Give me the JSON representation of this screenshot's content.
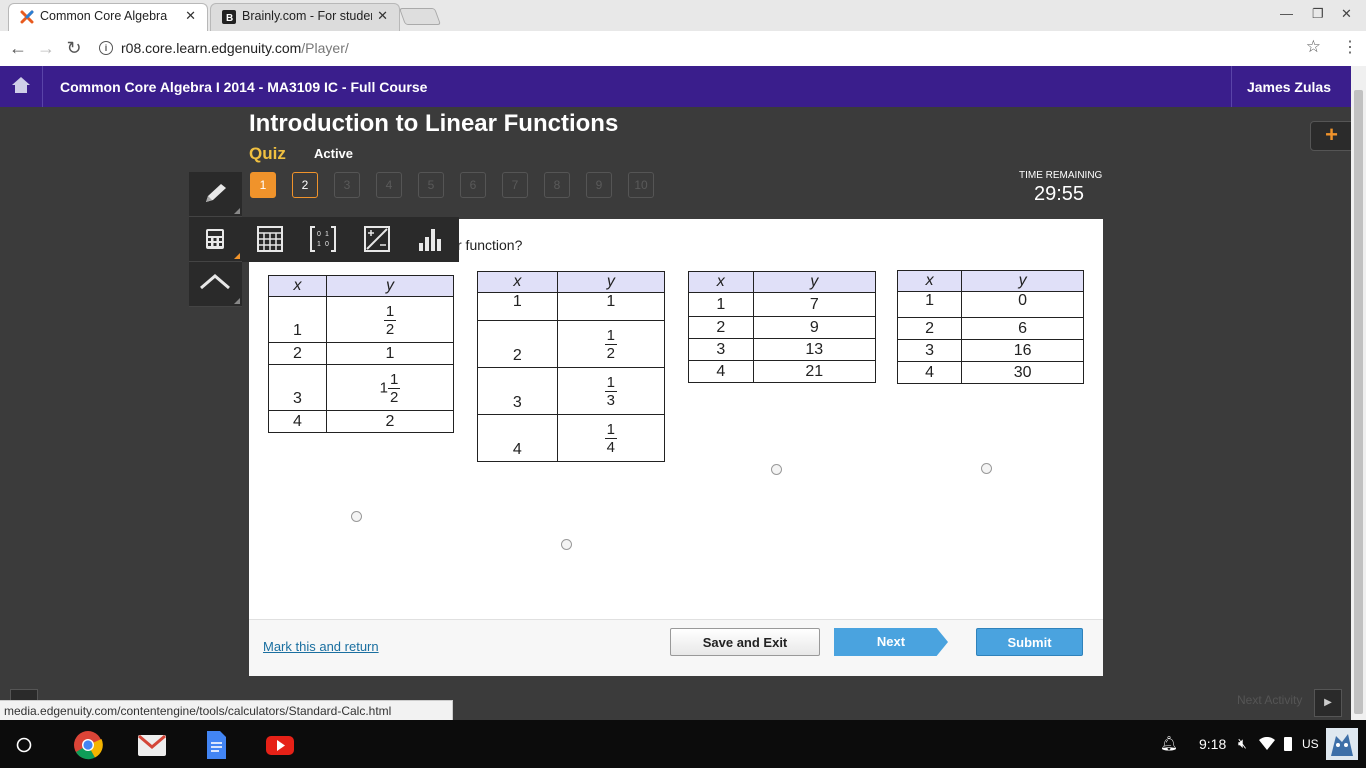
{
  "browser": {
    "tabs": [
      {
        "title": "Common Core Algebra I",
        "active": true
      },
      {
        "title": "Brainly.com - For students",
        "active": false
      }
    ],
    "url_host": "r08.core.learn.edgenuity.com",
    "url_path": "/Player/",
    "status_url": "media.edgenuity.com/contentengine/tools/calculators/Standard-Calc.html"
  },
  "course": {
    "title": "Common Core Algebra I 2014 - MA3109 IC - Full Course",
    "user": "James Zulas"
  },
  "lesson": {
    "title": "Introduction to Linear Functions",
    "type": "Quiz",
    "status": "Active"
  },
  "question_nav": [
    "1",
    "2",
    "3",
    "4",
    "5",
    "6",
    "7",
    "8",
    "9",
    "10"
  ],
  "timer": {
    "label": "TIME REMAINING",
    "value": "29:55"
  },
  "question": {
    "text_visible": "r function?",
    "tables": [
      {
        "headers": [
          "x",
          "y"
        ],
        "rows": [
          [
            "1",
            "1/2"
          ],
          [
            "2",
            "1"
          ],
          [
            "3",
            "1 1/2"
          ],
          [
            "4",
            "2"
          ]
        ]
      },
      {
        "headers": [
          "x",
          "y"
        ],
        "rows": [
          [
            "1",
            "1"
          ],
          [
            "2",
            "1/2"
          ],
          [
            "3",
            "1/3"
          ],
          [
            "4",
            "1/4"
          ]
        ]
      },
      {
        "headers": [
          "x",
          "y"
        ],
        "rows": [
          [
            "1",
            "7"
          ],
          [
            "2",
            "9"
          ],
          [
            "3",
            "13"
          ],
          [
            "4",
            "21"
          ]
        ]
      },
      {
        "headers": [
          "x",
          "y"
        ],
        "rows": [
          [
            "1",
            "0"
          ],
          [
            "2",
            "6"
          ],
          [
            "3",
            "16"
          ],
          [
            "4",
            "30"
          ]
        ]
      }
    ]
  },
  "footer": {
    "mark_link": "Mark this and return",
    "save_exit": "Save and Exit",
    "next": "Next",
    "submit": "Submit"
  },
  "bottom_nav": {
    "next_activity": "Next Activity"
  },
  "shelf": {
    "time": "9:18",
    "lang": "US"
  },
  "colors": {
    "course_bar": "#3a1e8c",
    "accent_orange": "#f0932b",
    "button_blue": "#4aa3df",
    "quiz_gold": "#f0c040"
  }
}
